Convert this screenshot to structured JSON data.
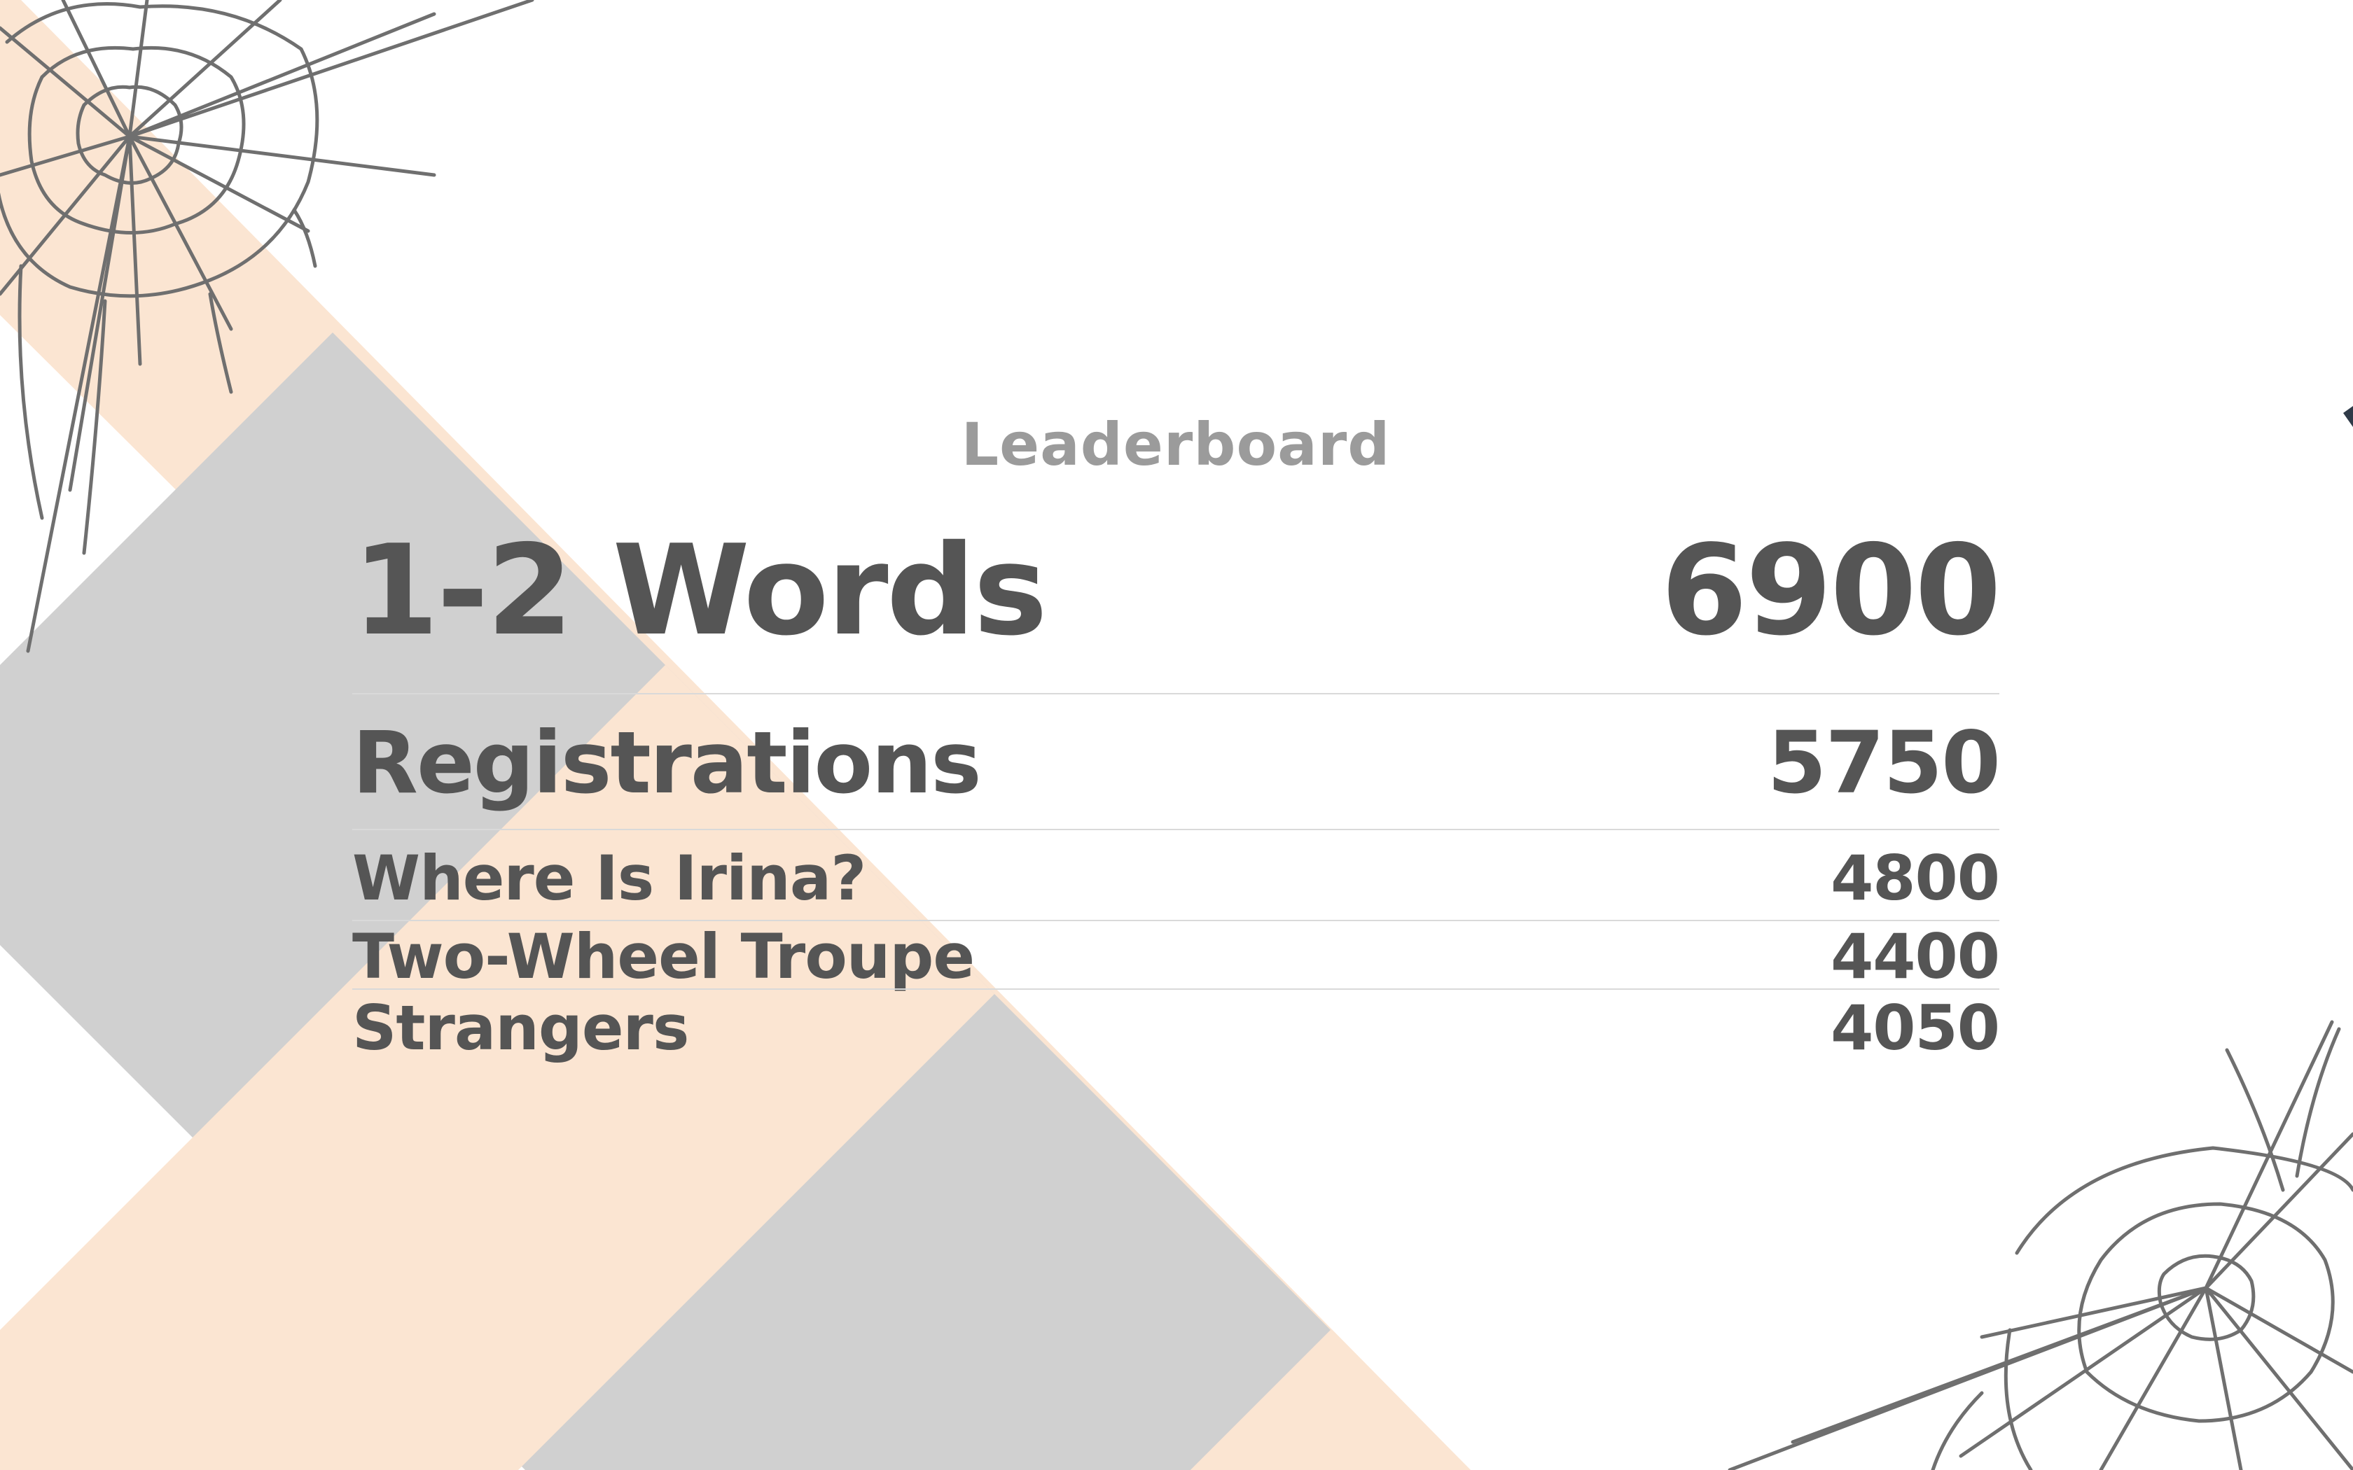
{
  "theme": {
    "title_color": "#9b9b9b",
    "text_color": "#555555",
    "rule_color": "#d9d9d9",
    "stripe_gray": "#d0d0d0",
    "stripe_peach": "#fbe5d2",
    "web_color": "#6f6f6f"
  },
  "leaderboard": {
    "title": "Leaderboard",
    "entries": [
      {
        "name": "1-2 Words",
        "score": "6900"
      },
      {
        "name": "Registrations",
        "score": "5750"
      },
      {
        "name": "Where Is Irina?",
        "score": "4800"
      },
      {
        "name": "Two-Wheel Troupe",
        "score": "4400"
      },
      {
        "name": "Strangers",
        "score": "4050"
      }
    ]
  }
}
